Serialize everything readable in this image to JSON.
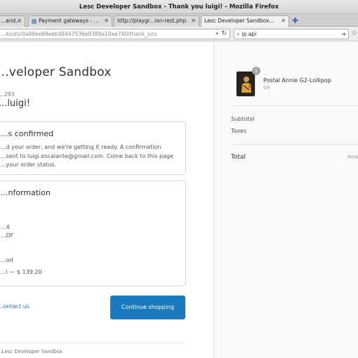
{
  "window": {
    "title": "Lesc Developer Sandbox - Thank you luigi! - Mozilla Firefox"
  },
  "tabs": [
    {
      "label": "...and..."
    },
    {
      "label": "Payment gateways - ..."
    },
    {
      "label": "http://playgr...ion-rest.php"
    },
    {
      "label": "Lesc Developer Sandbox..."
    }
  ],
  "navbar": {
    "url": "...kouts/0a00ee69aeb48447536e9388a10ae740/thank_you",
    "search_value": "ip api"
  },
  "page": {
    "shop_name": "...veloper Sandbox",
    "order_number": "...293",
    "thank_you": "...luigi!",
    "confirmed": {
      "title": "...s confirmed",
      "line1": "...d your order, and we're getting it ready. A confirmation",
      "line2": "...sent to luigi.escalante@gmail.com. Come back to this page",
      "line3": "...your order status."
    },
    "customer_info": {
      "title": "...nformation",
      "line1": "...4",
      "line2": "...DF",
      "line3": "...od",
      "line4": "...l — $ 139.20"
    },
    "contact_link": "...ontact us",
    "continue_button": "Continue shopping",
    "footer": "...Lesc Developer Sandbox"
  },
  "summary": {
    "product": {
      "name": "Postal Annie G2-Lollipop",
      "variant": "SM",
      "quantity": "1"
    },
    "subtotal_label": "Subtotal",
    "taxes_label": "Taxes",
    "total_label": "Total",
    "currency": "MXN"
  }
}
